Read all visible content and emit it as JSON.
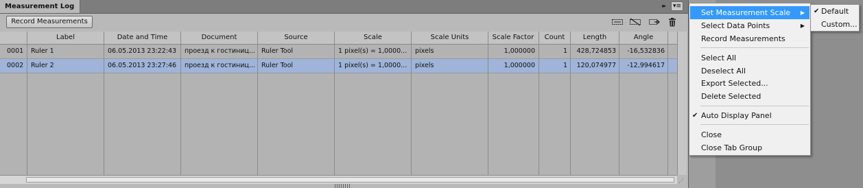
{
  "panel": {
    "tab_title": "Measurement Log",
    "collapse_glyph": "▸▸",
    "menu_glyph": "▾≡"
  },
  "toolbar": {
    "record_label": "Record Measurements",
    "icons": [
      "select-data-points-icon",
      "deselect-icon",
      "export-icon",
      "trash-icon"
    ]
  },
  "table": {
    "columns": [
      "",
      "Label",
      "Date and Time",
      "Document",
      "Source",
      "Scale",
      "Scale Units",
      "Scale Factor",
      "Count",
      "Length",
      "Angle"
    ],
    "rows": [
      {
        "id": "0001",
        "label": "Ruler 1",
        "datetime": "06.05.2013 23:22:43",
        "document": "проезд к гостиниц...",
        "source": "Ruler Tool",
        "scale": "1 pixel(s) = 1,0000...",
        "units": "pixels",
        "factor": "1,000000",
        "count": "1",
        "length": "428,724853",
        "angle": "-16,532836",
        "selected": false
      },
      {
        "id": "0002",
        "label": "Ruler 2",
        "datetime": "06.05.2013 23:27:46",
        "document": "проезд к гостиниц...",
        "source": "Ruler Tool",
        "scale": "1 pixel(s) = 1,0000...",
        "units": "pixels",
        "factor": "1,000000",
        "count": "1",
        "length": "120,074977",
        "angle": "-12,994617",
        "selected": true
      }
    ]
  },
  "menu": {
    "set_scale": "Set Measurement Scale",
    "select_points": "Select Data Points",
    "record": "Record Measurements",
    "select_all": "Select All",
    "deselect_all": "Deselect All",
    "export": "Export Selected...",
    "delete": "Delete Selected",
    "auto_display": "Auto Display Panel",
    "close": "Close",
    "close_group": "Close Tab Group"
  },
  "submenu": {
    "default": "Default",
    "custom": "Custom..."
  },
  "colors": {
    "highlight": "#3399ff",
    "selected_row": "#9fb4d8",
    "panel_bg": "#b9b9b9"
  }
}
